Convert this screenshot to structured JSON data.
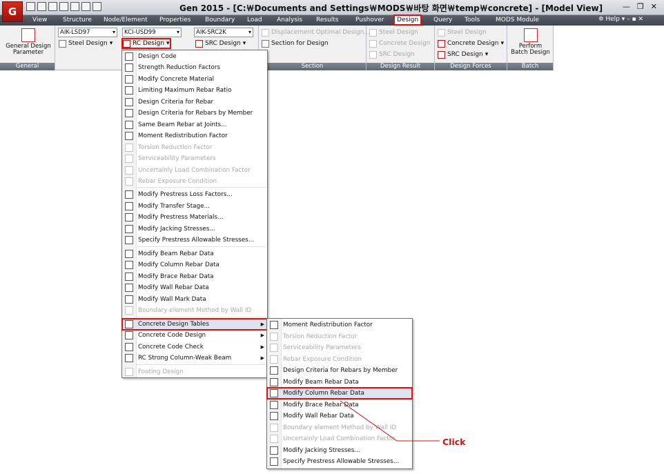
{
  "app": {
    "logo": "G",
    "title": "Gen 2015 - [C:￦Documents and Settings￦MODS￦바탕 화면￦temp￦concrete] - [Model View]"
  },
  "menubar": {
    "items": [
      "View",
      "Structure",
      "Node/Element",
      "Properties",
      "Boundary",
      "Load",
      "Analysis",
      "Results",
      "Pushover",
      "Design",
      "Query",
      "Tools",
      "MODS Module"
    ],
    "active": "Design",
    "help": "Help"
  },
  "ribbon": {
    "general": {
      "button": "General Design",
      "button2": "Parameter",
      "label": "General"
    },
    "codes": {
      "steel_code": "AIK-LSD97",
      "steel_btn": "Steel Design",
      "rc_code": "KCI-USD99",
      "rc_btn": "RC Design",
      "src_code": "AIK-SRC2K",
      "src_btn": "SRC Design"
    },
    "section": {
      "disp": "Displacement Optimal Design...",
      "sec": "Section for Design",
      "label": "Section"
    },
    "result": {
      "a": "Steel Design",
      "b": "Concrete Design",
      "c": "SRC Design",
      "label": "Design Result"
    },
    "forces": {
      "a": "Steel Design",
      "b": "Concrete Design",
      "c": "SRC Design",
      "label": "Design Forces"
    },
    "batch": {
      "btn1": "Perform",
      "btn2": "Batch Design",
      "label": "Batch"
    }
  },
  "rc_menu": [
    {
      "label": "Design Code",
      "enabled": true
    },
    {
      "label": "Strength Reduction Factors",
      "enabled": true
    },
    {
      "label": "Modify Concrete Material",
      "enabled": true
    },
    {
      "label": "Limiting Maximum Rebar Ratio",
      "enabled": true
    },
    {
      "label": "Design Criteria for Rebar",
      "enabled": true
    },
    {
      "label": "Design Criteria for Rebars by Member",
      "enabled": true
    },
    {
      "label": "Same Beam Rebar at Joints...",
      "enabled": true
    },
    {
      "label": "Moment Redistribution Factor",
      "enabled": true
    },
    {
      "label": "Torsion Reduction Factor",
      "enabled": false
    },
    {
      "label": "Serviceability Parameters",
      "enabled": false
    },
    {
      "label": "Uncertainly Load Combination Factor",
      "enabled": false
    },
    {
      "label": "Rebar Exposure Condition",
      "enabled": false
    },
    {
      "label": "Modify Prestress Loss Factors...",
      "enabled": true
    },
    {
      "label": "Modify Transfer Stage...",
      "enabled": true
    },
    {
      "label": "Modify Prestress Materials...",
      "enabled": true
    },
    {
      "label": "Modify Jacking Stresses...",
      "enabled": true
    },
    {
      "label": "Specify Prestress Allowable Stresses...",
      "enabled": true
    },
    {
      "label": "Modify Beam Rebar Data",
      "enabled": true
    },
    {
      "label": "Modify Column Rebar Data",
      "enabled": true
    },
    {
      "label": "Modify Brace Rebar Data",
      "enabled": true
    },
    {
      "label": "Modify Wall Rebar Data",
      "enabled": true
    },
    {
      "label": "Modify Wall Mark Data",
      "enabled": true
    },
    {
      "label": "Boundary element Method by Wall ID",
      "enabled": false
    },
    {
      "label": "Concrete Design Tables",
      "enabled": true
    },
    {
      "label": "Concrete Code Design",
      "enabled": true
    },
    {
      "label": "Concrete Code Check",
      "enabled": true
    },
    {
      "label": "RC Strong Column-Weak Beam",
      "enabled": true
    },
    {
      "label": "Footing Design",
      "enabled": false
    }
  ],
  "sub_menu": [
    {
      "label": "Moment Redistribution Factor",
      "enabled": true
    },
    {
      "label": "Torsion Reduction Factor",
      "enabled": false
    },
    {
      "label": "Serviceability Parameters",
      "enabled": false
    },
    {
      "label": "Rebar Exposure Condition",
      "enabled": false
    },
    {
      "label": "Design Criteria for Rebars by Member",
      "enabled": true
    },
    {
      "label": "Modify Beam Rebar Data",
      "enabled": true
    },
    {
      "label": "Modify Column Rebar Data",
      "enabled": true
    },
    {
      "label": "Modify Brace Rebar Data",
      "enabled": true
    },
    {
      "label": "Modify Wall Rebar Data",
      "enabled": true
    },
    {
      "label": "Boundary element Method by Wall ID",
      "enabled": false
    },
    {
      "label": "Uncertainly Load Combination Factor",
      "enabled": false
    },
    {
      "label": "Modify Jacking Stresses...",
      "enabled": true
    },
    {
      "label": "Specify Prestress Allowable Stresses...",
      "enabled": true
    }
  ],
  "annotation": {
    "text": "Click",
    "color": "#d41010"
  }
}
